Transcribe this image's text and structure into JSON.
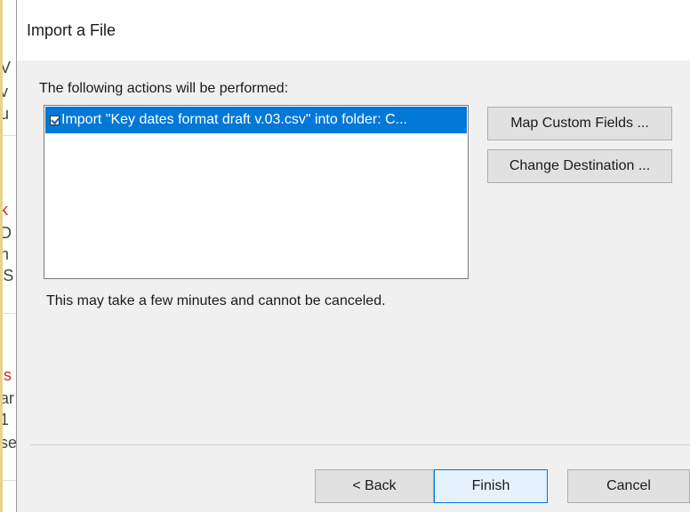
{
  "dialog": {
    "title": "Import a File",
    "actions_label": "The following actions will be performed:",
    "actions": [
      {
        "label": "Import \"Key dates format draft v.03.csv\" into folder: C...",
        "checked": true,
        "selected": true
      }
    ],
    "note": "This may take a few minutes and cannot be canceled.",
    "buttons": {
      "map_custom_fields": "Map Custom Fields ...",
      "change_destination": "Change Destination ...",
      "back": "< Back",
      "finish": "Finish",
      "cancel": "Cancel"
    }
  },
  "background_window": {
    "fragments": [
      "V",
      "v",
      "u",
      "k",
      "D",
      "h",
      "'S",
      "js",
      "ar",
      "1",
      "se"
    ]
  },
  "colors": {
    "selection": "#0078d7",
    "dialog_bg": "#f0f0f0",
    "title_bg": "#ffffff",
    "accent_red": "#c42b1c"
  }
}
